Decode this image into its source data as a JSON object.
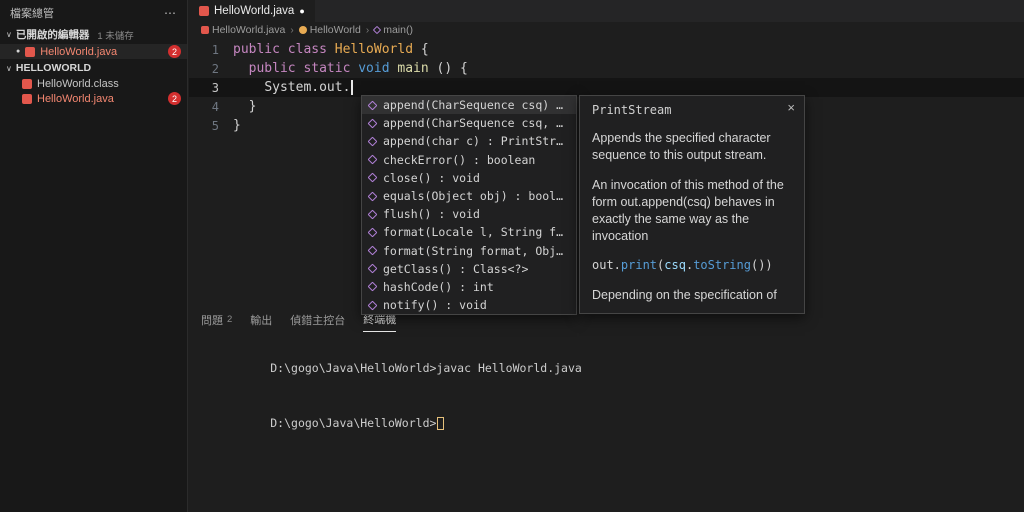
{
  "colors": {
    "error_red": "#f48771",
    "badge_bg": "#d32f2f",
    "keyword_purple": "#c586c0",
    "class_orange": "#e8ab53",
    "type_blue": "#569cd6",
    "method_icon_purple": "#b180d7",
    "terminal_cursor": "#e5c07b"
  },
  "sidebar": {
    "title": "檔案總管",
    "more_icon": "⋯",
    "open_editors": {
      "chevron": "∨",
      "label": "已開啟的編輯器",
      "hint": "1 未儲存",
      "item": {
        "dot": "●",
        "name": "HelloWorld.java",
        "badge": "2"
      }
    },
    "folder": {
      "chevron": "∨",
      "label": "HELLOWORLD",
      "items": [
        {
          "name": "HelloWorld.class",
          "badge": ""
        },
        {
          "name": "HelloWorld.java",
          "badge": "2"
        }
      ]
    }
  },
  "tabbar": {
    "tab_label": "HelloWorld.java",
    "modified_dot": "●"
  },
  "breadcrumb": {
    "items": [
      "HelloWorld.java",
      "HelloWorld",
      "main()"
    ],
    "separator": "›"
  },
  "editor": {
    "lines": [
      {
        "num": "1",
        "tokens": [
          {
            "t": "public class ",
            "c": "kw"
          },
          {
            "t": "HelloWorld",
            "c": "cls"
          },
          {
            "t": " {",
            "c": "fg"
          }
        ]
      },
      {
        "num": "2",
        "tokens": [
          {
            "t": "  ",
            "c": "fg"
          },
          {
            "t": "public static ",
            "c": "kw"
          },
          {
            "t": "void",
            "c": "type"
          },
          {
            "t": " ",
            "c": "fg"
          },
          {
            "t": "main",
            "c": "fn"
          },
          {
            "t": " () {",
            "c": "fg"
          }
        ]
      },
      {
        "num": "3",
        "active": true,
        "cursor": true,
        "tokens": [
          {
            "t": "    ",
            "c": "fg"
          },
          {
            "t": "System.out.",
            "c": "fg"
          }
        ]
      },
      {
        "num": "4",
        "tokens": [
          {
            "t": "  }",
            "c": "fg"
          }
        ]
      },
      {
        "num": "5",
        "tokens": [
          {
            "t": "}",
            "c": "fg"
          }
        ]
      }
    ]
  },
  "suggest": {
    "items": [
      {
        "label": "append(CharSequence csq) …",
        "selected": true
      },
      {
        "label": "append(CharSequence csq, …"
      },
      {
        "label": "append(char c) : PrintStr…"
      },
      {
        "label": "checkError() : boolean"
      },
      {
        "label": "close() : void"
      },
      {
        "label": "equals(Object obj) : bool…"
      },
      {
        "label": "flush() : void"
      },
      {
        "label": "format(Locale l, String f…"
      },
      {
        "label": "format(String format, Obj…"
      },
      {
        "label": "getClass() : Class<?>"
      },
      {
        "label": "hashCode() : int"
      },
      {
        "label": "notify() : void"
      }
    ]
  },
  "docs": {
    "title": "PrintStream",
    "close_icon": "×",
    "p1": "Appends the specified character sequence to this output stream.",
    "p2": "An invocation of this method of the form out.append(csq) behaves in exactly the same way as the invocation",
    "code_tokens": [
      {
        "t": "out.",
        "c": "fg"
      },
      {
        "t": "print",
        "c": "type"
      },
      {
        "t": "(",
        "c": "fg"
      },
      {
        "t": "csq",
        "c": "lblue"
      },
      {
        "t": ".",
        "c": "fg"
      },
      {
        "t": "toString",
        "c": "type"
      },
      {
        "t": "())",
        "c": "fg"
      }
    ],
    "p3": "Depending on the specification of"
  },
  "panel": {
    "tabs": [
      {
        "label": "問題",
        "badge": "2"
      },
      {
        "label": "輸出"
      },
      {
        "label": "偵錯主控台"
      },
      {
        "label": "終端機",
        "active": true
      }
    ],
    "terminal_lines": [
      "D:\\gogo\\Java\\HelloWorld>javac HelloWorld.java",
      "D:\\gogo\\Java\\HelloWorld>"
    ]
  }
}
